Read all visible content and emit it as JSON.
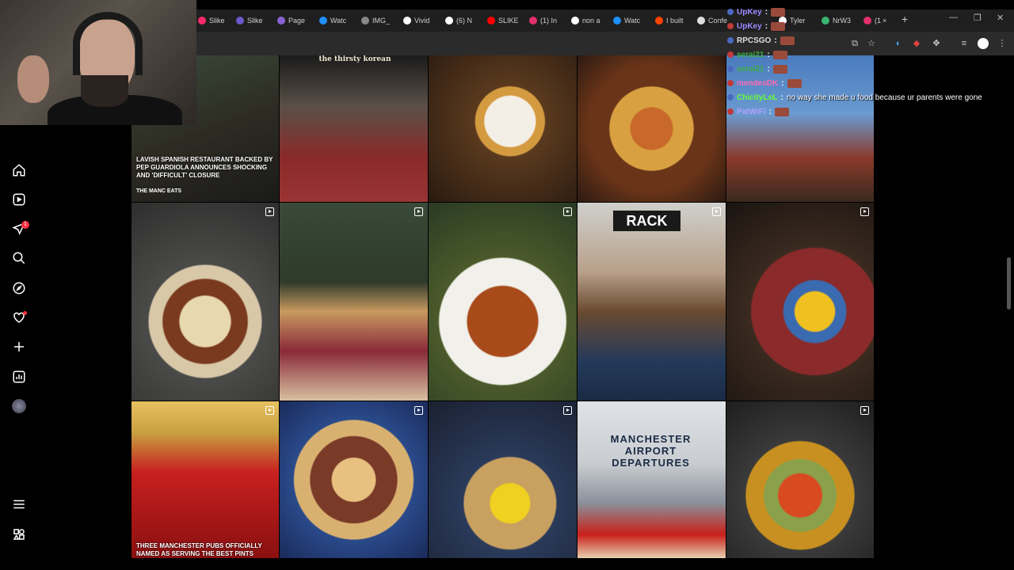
{
  "browser": {
    "tabs": [
      {
        "label": "Slike",
        "color": "#ff2a6d"
      },
      {
        "label": "Slike",
        "color": "#6a5acd"
      },
      {
        "label": "Page",
        "color": "#8a63d2"
      },
      {
        "label": "Watc",
        "color": "#1e90ff"
      },
      {
        "label": "IMG_",
        "color": "#888888"
      },
      {
        "label": "Vivid",
        "color": "#ffffff"
      },
      {
        "label": "(6) N",
        "color": "#ffffff"
      },
      {
        "label": "SLIKE",
        "color": "#ff0000"
      },
      {
        "label": "(1) In",
        "color": "#e1306c"
      },
      {
        "label": "non a",
        "color": "#ffffff"
      },
      {
        "label": "Watc",
        "color": "#1e90ff"
      },
      {
        "label": "I built",
        "color": "#ff4500"
      },
      {
        "label": "Confe",
        "color": "#dddddd"
      },
      {
        "label": "Tyler",
        "color": "#ffffff"
      },
      {
        "label": "NrW3",
        "color": "#3cb371"
      },
      {
        "label": "(1",
        "color": "#e1306c"
      }
    ],
    "new_tab": "+",
    "close_tab": "×",
    "win_min": "—",
    "win_max": "❐",
    "win_close": "✕"
  },
  "sidebar": {
    "badge": "1",
    "items": [
      "home-icon",
      "reels-icon",
      "messages-icon",
      "search-icon",
      "explore-icon",
      "notifications-icon",
      "create-icon",
      "dashboard-icon",
      "profile-avatar"
    ],
    "bottom": [
      "menu-icon",
      "threads-icon"
    ]
  },
  "grid": {
    "tiles": [
      {
        "caption": "LAVISH SPANISH RESTAURANT BACKED BY PEP GUARDIOLA ANNOUNCES SHOCKING AND 'DIFFICULT' CLOSURE",
        "brand": "THE MANC EATS",
        "bg": "linear-gradient(160deg,#3a4a3a,#2c2a22 55%,#1a1a1a)"
      },
      {
        "sign": "the thirsty korean",
        "bg": "linear-gradient(180deg,#1b1b1b 0%,#5a5048 35%,#8a2a2a 70%,#9b3434 100%)"
      },
      {
        "bg": "radial-gradient(circle at 55% 45%,#f4efe6 0 22%,#d49a40 23% 30%,#5a3a1e 31%,#2a1a10 100%)"
      },
      {
        "bg": "radial-gradient(circle at 50% 50%,#c8682a 0 20%,#d8a040 21% 40%,#6a3418 41% 60%,#2b1a12 100%)"
      },
      {
        "bg": "linear-gradient(180deg,#4a7bbd 0%,#6a9ad0 40%,#8a3a2a 70%,#3a2a20 100%)"
      },
      {
        "bg": "radial-gradient(circle at 50% 60%,#e8d8b0 0 18%,#7a3a1e 19% 30%,#d8c8a8 31% 40%,#4a4a48 41%,#2e2e2e 100%)",
        "reel": true
      },
      {
        "bg": "linear-gradient(180deg,#3a4a38 0%,#2e3a2a 40%,#c89a60 55%,#8a2a3a 75%,#d8c0a0 100%)",
        "reel": true
      },
      {
        "bg": "radial-gradient(circle at 50% 60%,#a84a1a 0 25%,#f2f0ea 26% 45%,#4a5a2a 46%,#2a3a24 100%)",
        "reel": true
      },
      {
        "sign": "RACK",
        "bg": "linear-gradient(180deg,#d0d0cc 0%,#b8a08a 35%,#6a4a30 55%,#243a5a 80%,#1a2a44 100%)",
        "reel": true
      },
      {
        "bg": "radial-gradient(circle at 60% 55%,#f0c020 0 14%,#3a6ab0 15% 22%,#8a2a2a 23% 45%,#3a2a20 46%,#1a1410 100%)",
        "reel": true
      },
      {
        "caption": "THREE MANCHESTER PUBS OFFICIALLY NAMED AS SERVING THE BEST PINTS",
        "bg": "linear-gradient(180deg,#e8c060 0%,#c8a040 20%,#c82020 45%,#8a1010 100%)",
        "reel": true
      },
      {
        "bg": "radial-gradient(circle at 50% 50%,#e8c080 0 20%,#7a3a28 21% 40%,#d8b070 41% 55%,#2a4a8a 56%,#1a2a5a 100%)",
        "reel": true
      },
      {
        "bg": "radial-gradient(circle at 55% 65%,#f0d020 0 15%,#c8a060 16% 35%,#2a3a5a 36%,#1a2030 100%)",
        "reel": true
      },
      {
        "sign": "MANCHESTER AIRPORT DEPARTURES",
        "bg": "linear-gradient(180deg,#e0e4e8 0%,#c8ccd0 40%,#8a909a 65%,#c8201a 85%,#e8d0b0 100%)"
      },
      {
        "bg": "radial-gradient(circle at 50% 60%,#d84a20 0 18%,#8aa04a 19% 30%,#c89020 31% 45%,#3a3a3a 46%,#1e1e1e 100%)",
        "reel": true
      }
    ]
  },
  "chat": [
    {
      "user": "UpKey",
      "color": "#9b8bff",
      "text": ""
    },
    {
      "user": "UpKey",
      "color": "#9b8bff",
      "text": ""
    },
    {
      "user": "RPCSGO",
      "color": "#dddddd",
      "text": ""
    },
    {
      "user": "serai21",
      "color": "#3cb043",
      "text": ""
    },
    {
      "user": "serai21",
      "color": "#3cb043",
      "text": ""
    },
    {
      "user": "mendesDK",
      "color": "#ff69b4",
      "text": ""
    },
    {
      "user": "ChicityLoL",
      "color": "#66ff33",
      "text": "no way she made u food because ur parents were gone"
    },
    {
      "user": "PatWiFi",
      "color": "#b0a0ff",
      "text": ""
    }
  ]
}
